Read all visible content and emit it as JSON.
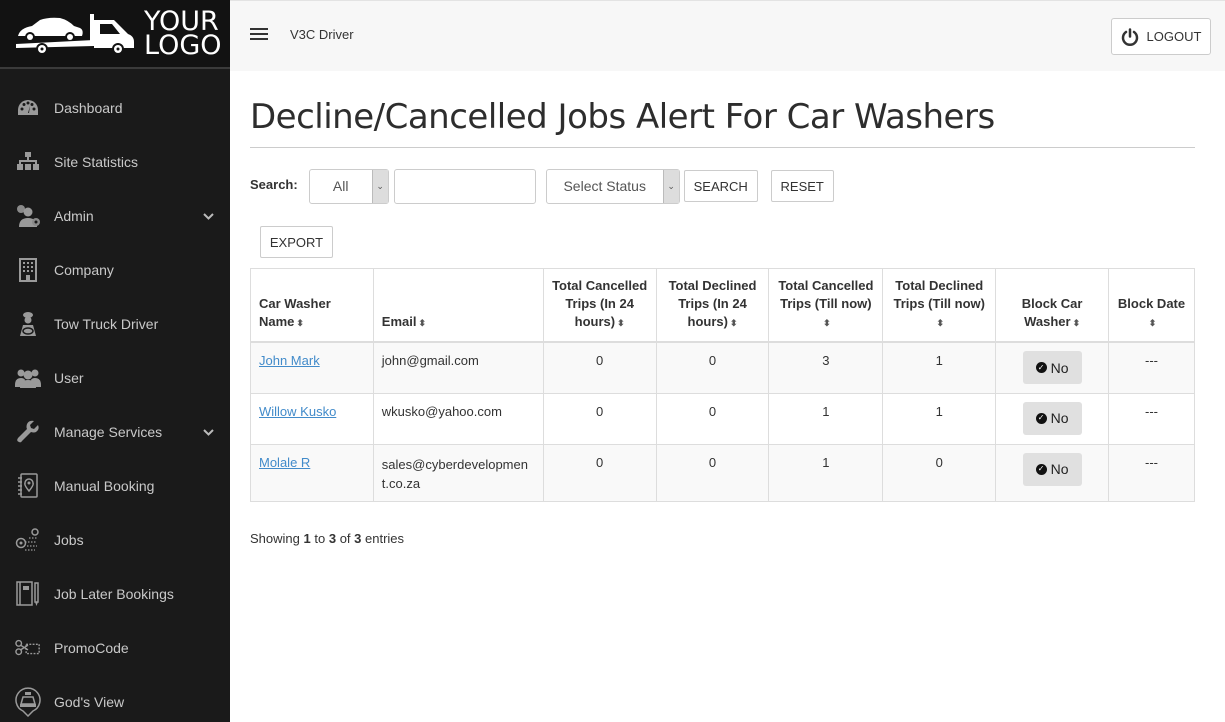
{
  "sidebar": {
    "logo_text_line1": "YOUR",
    "logo_text_line2": "LOGO",
    "items": [
      {
        "label": "Dashboard",
        "icon": "dashboard-gauge-icon",
        "has_submenu": false
      },
      {
        "label": "Site Statistics",
        "icon": "sitemap-icon",
        "has_submenu": false
      },
      {
        "label": "Admin",
        "icon": "users-cog-icon",
        "has_submenu": true
      },
      {
        "label": "Company",
        "icon": "building-icon",
        "has_submenu": false
      },
      {
        "label": "Tow Truck Driver",
        "icon": "driver-icon",
        "has_submenu": false
      },
      {
        "label": "User",
        "icon": "users-icon",
        "has_submenu": false
      },
      {
        "label": "Manage Services",
        "icon": "wrench-icon",
        "has_submenu": true
      },
      {
        "label": "Manual Booking",
        "icon": "booking-notebook-icon",
        "has_submenu": false
      },
      {
        "label": "Jobs",
        "icon": "route-pin-icon",
        "has_submenu": false
      },
      {
        "label": "Job Later Bookings",
        "icon": "notebook-pen-icon",
        "has_submenu": false
      },
      {
        "label": "PromoCode",
        "icon": "scissors-coupon-icon",
        "has_submenu": false
      },
      {
        "label": "God's View",
        "icon": "taxi-pin-icon",
        "has_submenu": false
      }
    ]
  },
  "topbar": {
    "app_name": "V3C Driver",
    "logout_label": "LOGOUT"
  },
  "main": {
    "title": "Decline/Cancelled Jobs Alert For Car Washers",
    "filters": {
      "label": "Search:",
      "type_select_value": "All",
      "search_value": "",
      "status_select_value": "Select Status",
      "search_button": "SEARCH",
      "reset_button": "RESET",
      "export_button": "EXPORT"
    },
    "table": {
      "columns": [
        "Car Washer Name",
        "Email",
        "Total Cancelled Trips (In 24 hours)",
        "Total Declined Trips (In 24 hours)",
        "Total Cancelled Trips (Till now)",
        "Total Declined Trips (Till now)",
        "Block Car Washer",
        "Block Date"
      ],
      "rows": [
        {
          "name": "John Mark",
          "email": "john@gmail.com",
          "cancelled_24h": "0",
          "declined_24h": "0",
          "cancelled_total": "3",
          "declined_total": "1",
          "block": "No",
          "block_date": "---"
        },
        {
          "name": "Willow Kusko",
          "email": "wkusko@yahoo.com",
          "cancelled_24h": "0",
          "declined_24h": "0",
          "cancelled_total": "1",
          "declined_total": "1",
          "block": "No",
          "block_date": "---"
        },
        {
          "name": "Molale R",
          "email": "sales@cyberdevelopment.co.za",
          "cancelled_24h": "0",
          "declined_24h": "0",
          "cancelled_total": "1",
          "declined_total": "0",
          "block": "No",
          "block_date": "---"
        }
      ]
    },
    "info": {
      "prefix": "Showing",
      "from": "1",
      "to_word": "to",
      "to": "3",
      "of_word": "of",
      "total": "3",
      "suffix": "entries"
    }
  }
}
